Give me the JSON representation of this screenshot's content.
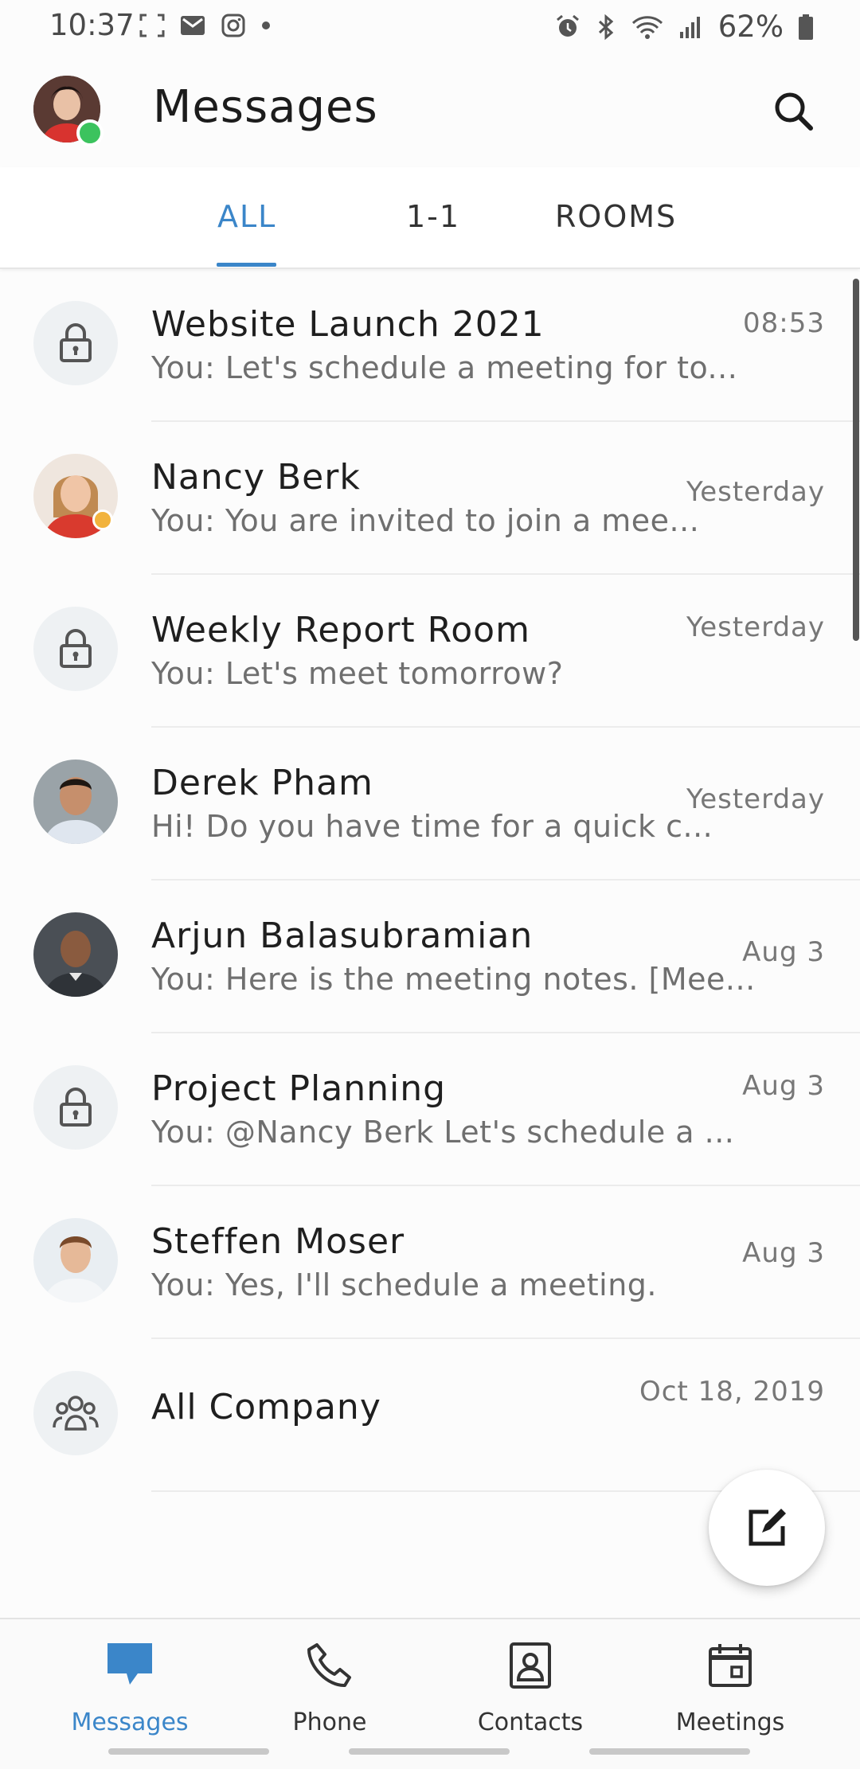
{
  "status_bar": {
    "time": "10:37",
    "battery": "62%"
  },
  "header": {
    "title": "Messages",
    "presence_color": "#3cc35e"
  },
  "tabs": [
    {
      "label": "ALL",
      "active": true
    },
    {
      "label": "1-1",
      "active": false
    },
    {
      "label": "ROOMS",
      "active": false
    }
  ],
  "conversations": [
    {
      "name": "Website Launch 2021",
      "preview": "You: Let's schedule a meeting for to...",
      "time": "08:53",
      "icon": "lock-icon"
    },
    {
      "name": "Nancy Berk",
      "preview": "You: You are invited to join a mee...",
      "time": "Yesterday",
      "icon": "avatar",
      "status": "away"
    },
    {
      "name": "Weekly Report Room",
      "preview": "You: Let's meet tomorrow?",
      "time": "Yesterday",
      "icon": "lock-icon"
    },
    {
      "name": "Derek Pham",
      "preview": "Hi! Do you have time for a quick c...",
      "time": "Yesterday",
      "icon": "avatar"
    },
    {
      "name": "Arjun Balasubramian",
      "preview": "You: Here is the meeting notes. [Mee...",
      "time": "Aug 3",
      "icon": "avatar"
    },
    {
      "name": "Project Planning",
      "preview": "You: @Nancy Berk Let's schedule a ...",
      "time": "Aug 3",
      "icon": "lock-icon"
    },
    {
      "name": "Steffen Moser",
      "preview": "You: Yes, I'll schedule a meeting.",
      "time": "Aug 3",
      "icon": "avatar"
    },
    {
      "name": "All Company",
      "preview": "",
      "time": "Oct 18, 2019",
      "icon": "group-icon"
    }
  ],
  "bottom_nav": [
    {
      "label": "Messages",
      "icon": "chat-icon",
      "active": true
    },
    {
      "label": "Phone",
      "icon": "phone-icon",
      "active": false
    },
    {
      "label": "Contacts",
      "icon": "contacts-icon",
      "active": false
    },
    {
      "label": "Meetings",
      "icon": "calendar-icon",
      "active": false
    }
  ],
  "colors": {
    "accent": "#3b86c9",
    "away": "#f2b33d",
    "online": "#3cc35e"
  }
}
